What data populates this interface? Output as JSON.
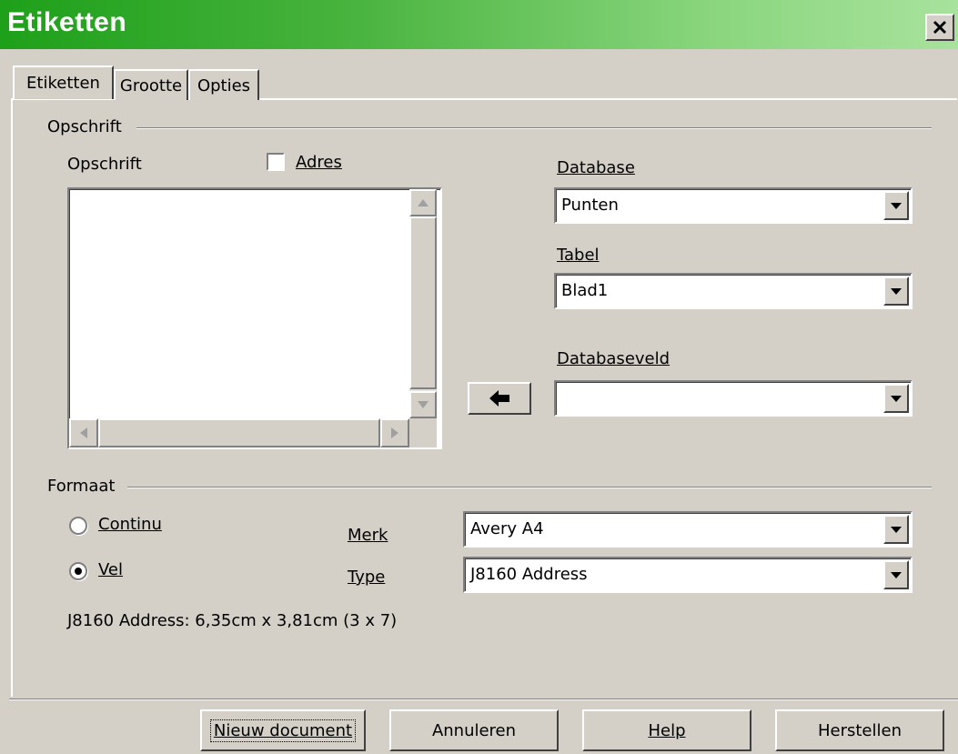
{
  "window": {
    "title": "Etiketten",
    "close_glyph": "X"
  },
  "tabs": [
    {
      "label": "Etiketten",
      "active": true
    },
    {
      "label": "Grootte",
      "active": false
    },
    {
      "label": "Opties",
      "active": false
    }
  ],
  "opschrift_group": {
    "title": "Opschrift",
    "text_label": "Opschrift",
    "address_checkbox": {
      "label": "Adres",
      "checked": false
    },
    "text_value": ""
  },
  "database": {
    "database_label": "Database",
    "database_value": "Punten",
    "table_label": "Tabel",
    "table_value": "Blad1",
    "field_label": "Databaseveld",
    "field_value": "",
    "insert_icon": "arrow-left-icon"
  },
  "format_group": {
    "title": "Formaat",
    "radio_continu": {
      "label": "Continu",
      "selected": false
    },
    "radio_vel": {
      "label": "Vel",
      "selected": true
    },
    "brand_label": "Merk",
    "brand_value": "Avery A4",
    "type_label": "Type",
    "type_value": "J8160 Address",
    "info": "J8160 Address: 6,35cm x 3,81cm (3 x 7)"
  },
  "buttons": {
    "new_document": "Nieuw document",
    "cancel": "Annuleren",
    "help": "Help",
    "reset": "Herstellen"
  }
}
